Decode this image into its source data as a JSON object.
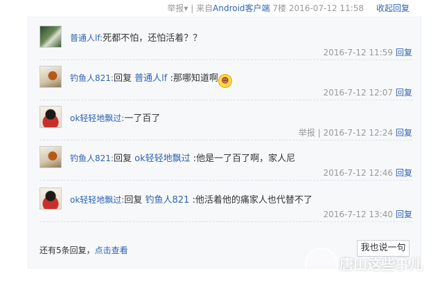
{
  "topbar": {
    "report": "举报",
    "report_caret": "▾",
    "sep": "|",
    "source_prefix": "来自",
    "source_link": "Android客户端",
    "floor": "7楼",
    "datetime": "2016-07-12 11:58",
    "collapse": "收起回复"
  },
  "replies": [
    {
      "user": "普通人lf",
      "colon": ":",
      "reply_word": "",
      "reply_to": "",
      "text": "死都不怕，还怕活着？？",
      "report": "",
      "time": "2016-7-12 11:59",
      "reply_label": "回复"
    },
    {
      "user": "钓鱼人821",
      "colon": ":",
      "reply_word": "回复",
      "reply_to": "普通人lf",
      "text": ":那哪知道啊",
      "report": "",
      "time": "2016-7-12 12:07",
      "reply_label": "回复"
    },
    {
      "user": "ok轻轻地飘过",
      "colon": ":",
      "reply_word": "",
      "reply_to": "",
      "text": "一了百了",
      "report": "举报 |",
      "time": "2016-7-12 12:24",
      "reply_label": "回复"
    },
    {
      "user": "钓鱼人821",
      "colon": ":",
      "reply_word": "回复",
      "reply_to": "ok轻轻地飘过",
      "text": ":他是一了百了啊，家人尼",
      "report": "",
      "time": "2016-7-12 12:46",
      "reply_label": "回复"
    },
    {
      "user": "ok轻轻地飘过",
      "colon": ":",
      "reply_word": "回复",
      "reply_to": "钓鱼人821",
      "text": ":他活着他的痛家人也代替不了",
      "report": "",
      "time": "2016-7-12 13:40",
      "reply_label": "回复"
    }
  ],
  "more": {
    "text": "还有5条回复，",
    "link": "点击查看"
  },
  "reply_button": "我也说一句",
  "watermark": {
    "text": "唐山这些事儿",
    "icon": "watermark-logo-icon"
  },
  "colors": {
    "link": "#2d64b3",
    "panel_bg": "#f7f8fa",
    "meta_text": "#999999"
  }
}
